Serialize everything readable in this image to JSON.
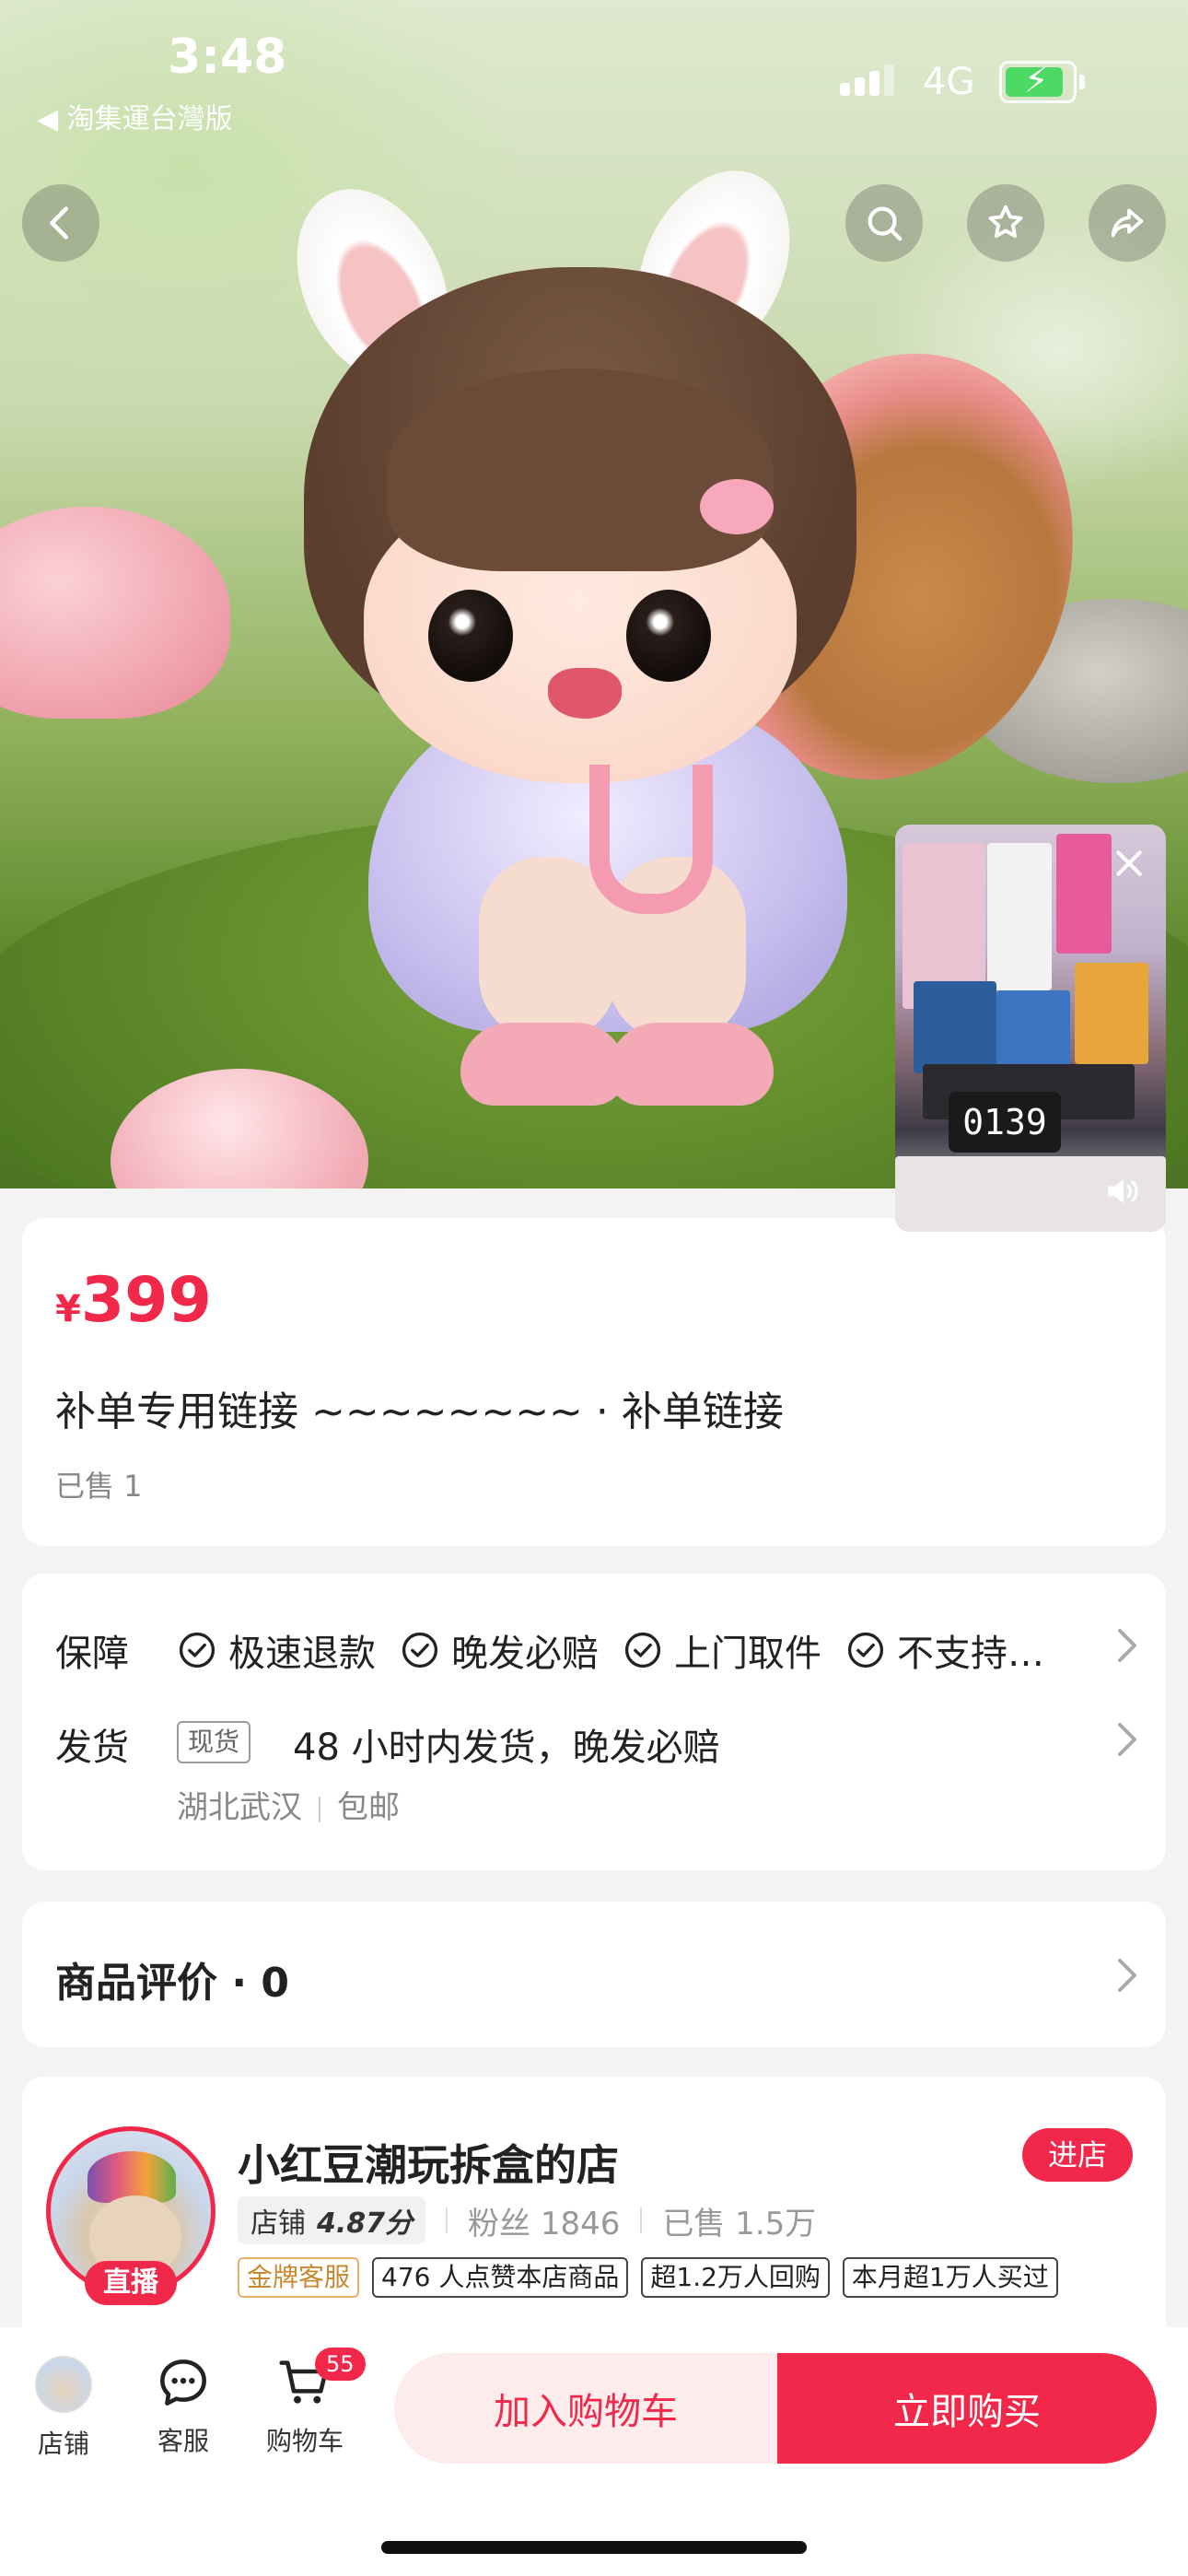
{
  "status_bar": {
    "time": "3:48",
    "back_app": "◀ 淘集運台灣版",
    "network": "4G"
  },
  "top_icons": [
    "back-icon",
    "search-icon",
    "star-icon",
    "share-icon"
  ],
  "product": {
    "currency": "¥",
    "price": "399",
    "title": "补单专用链接 ~~~~~~~~ · 补单链接",
    "sold": "已售 1"
  },
  "services": {
    "guarantee_label": "保障",
    "guarantees": [
      "极速退款",
      "晚发必赔",
      "上门取件",
      "不支持…"
    ],
    "shipping_label": "发货",
    "stock_tag": "现货",
    "shipping_text": "48 小时内发货，晚发必赔",
    "origin": "湖北武汉",
    "postage": "包邮"
  },
  "reviews": {
    "title": "商品评价 · 0"
  },
  "shop": {
    "name": "小红豆潮玩拆盒的店",
    "enter_label": "进店",
    "live_label": "直播",
    "rating_label": "店铺",
    "rating_value": "4.87分",
    "fans": "粉丝 1846",
    "sold": "已售 1.5万",
    "tags": [
      "金牌客服",
      "476 人点赞本店商品",
      "超1.2万人回购",
      "本月超1万人买过"
    ]
  },
  "video": {
    "clock": "0139"
  },
  "bottom_bar": {
    "shop_label": "店铺",
    "service_label": "客服",
    "cart_label": "购物车",
    "cart_count": "55",
    "add_to_cart": "加入购物车",
    "buy_now": "立即购买"
  },
  "colors": {
    "accent": "#f2284b",
    "accent_light": "#fdecec",
    "battery": "#4cd964"
  }
}
